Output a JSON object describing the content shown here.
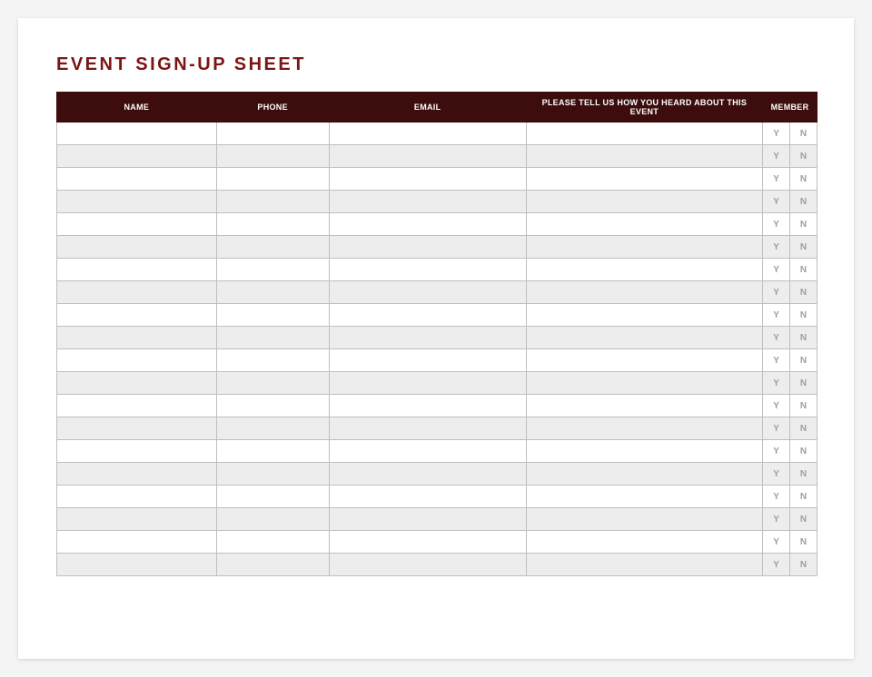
{
  "title": "EVENT SIGN-UP SHEET",
  "columns": {
    "name": "NAME",
    "phone": "PHONE",
    "email": "EMAIL",
    "how": "PLEASE TELL US HOW YOU HEARD ABOUT THIS EVENT",
    "member": "MEMBER"
  },
  "member_labels": {
    "yes": "Y",
    "no": "N"
  },
  "rows": [
    {
      "name": "",
      "phone": "",
      "email": "",
      "how": "",
      "yes": "Y",
      "no": "N"
    },
    {
      "name": "",
      "phone": "",
      "email": "",
      "how": "",
      "yes": "Y",
      "no": "N"
    },
    {
      "name": "",
      "phone": "",
      "email": "",
      "how": "",
      "yes": "Y",
      "no": "N"
    },
    {
      "name": "",
      "phone": "",
      "email": "",
      "how": "",
      "yes": "Y",
      "no": "N"
    },
    {
      "name": "",
      "phone": "",
      "email": "",
      "how": "",
      "yes": "Y",
      "no": "N"
    },
    {
      "name": "",
      "phone": "",
      "email": "",
      "how": "",
      "yes": "Y",
      "no": "N"
    },
    {
      "name": "",
      "phone": "",
      "email": "",
      "how": "",
      "yes": "Y",
      "no": "N"
    },
    {
      "name": "",
      "phone": "",
      "email": "",
      "how": "",
      "yes": "Y",
      "no": "N"
    },
    {
      "name": "",
      "phone": "",
      "email": "",
      "how": "",
      "yes": "Y",
      "no": "N"
    },
    {
      "name": "",
      "phone": "",
      "email": "",
      "how": "",
      "yes": "Y",
      "no": "N"
    },
    {
      "name": "",
      "phone": "",
      "email": "",
      "how": "",
      "yes": "Y",
      "no": "N"
    },
    {
      "name": "",
      "phone": "",
      "email": "",
      "how": "",
      "yes": "Y",
      "no": "N"
    },
    {
      "name": "",
      "phone": "",
      "email": "",
      "how": "",
      "yes": "Y",
      "no": "N"
    },
    {
      "name": "",
      "phone": "",
      "email": "",
      "how": "",
      "yes": "Y",
      "no": "N"
    },
    {
      "name": "",
      "phone": "",
      "email": "",
      "how": "",
      "yes": "Y",
      "no": "N"
    },
    {
      "name": "",
      "phone": "",
      "email": "",
      "how": "",
      "yes": "Y",
      "no": "N"
    },
    {
      "name": "",
      "phone": "",
      "email": "",
      "how": "",
      "yes": "Y",
      "no": "N"
    },
    {
      "name": "",
      "phone": "",
      "email": "",
      "how": "",
      "yes": "Y",
      "no": "N"
    },
    {
      "name": "",
      "phone": "",
      "email": "",
      "how": "",
      "yes": "Y",
      "no": "N"
    },
    {
      "name": "",
      "phone": "",
      "email": "",
      "how": "",
      "yes": "Y",
      "no": "N"
    }
  ]
}
